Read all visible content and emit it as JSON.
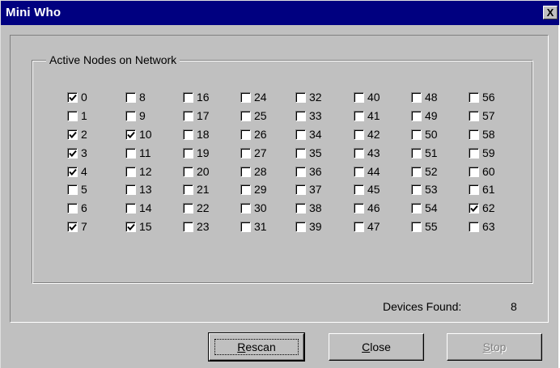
{
  "window": {
    "title": "Mini Who",
    "close_glyph": "X"
  },
  "group": {
    "label": "Active Nodes on Network"
  },
  "nodes": [
    {
      "id": "0",
      "checked": true
    },
    {
      "id": "1",
      "checked": false
    },
    {
      "id": "2",
      "checked": true
    },
    {
      "id": "3",
      "checked": true
    },
    {
      "id": "4",
      "checked": true
    },
    {
      "id": "5",
      "checked": false
    },
    {
      "id": "6",
      "checked": false
    },
    {
      "id": "7",
      "checked": true
    },
    {
      "id": "8",
      "checked": false
    },
    {
      "id": "9",
      "checked": false
    },
    {
      "id": "10",
      "checked": true
    },
    {
      "id": "11",
      "checked": false
    },
    {
      "id": "12",
      "checked": false
    },
    {
      "id": "13",
      "checked": false
    },
    {
      "id": "14",
      "checked": false
    },
    {
      "id": "15",
      "checked": true
    },
    {
      "id": "16",
      "checked": false
    },
    {
      "id": "17",
      "checked": false
    },
    {
      "id": "18",
      "checked": false
    },
    {
      "id": "19",
      "checked": false
    },
    {
      "id": "20",
      "checked": false
    },
    {
      "id": "21",
      "checked": false
    },
    {
      "id": "22",
      "checked": false
    },
    {
      "id": "23",
      "checked": false
    },
    {
      "id": "24",
      "checked": false
    },
    {
      "id": "25",
      "checked": false
    },
    {
      "id": "26",
      "checked": false
    },
    {
      "id": "27",
      "checked": false
    },
    {
      "id": "28",
      "checked": false
    },
    {
      "id": "29",
      "checked": false
    },
    {
      "id": "30",
      "checked": false
    },
    {
      "id": "31",
      "checked": false
    },
    {
      "id": "32",
      "checked": false
    },
    {
      "id": "33",
      "checked": false
    },
    {
      "id": "34",
      "checked": false
    },
    {
      "id": "35",
      "checked": false
    },
    {
      "id": "36",
      "checked": false
    },
    {
      "id": "37",
      "checked": false
    },
    {
      "id": "38",
      "checked": false
    },
    {
      "id": "39",
      "checked": false
    },
    {
      "id": "40",
      "checked": false
    },
    {
      "id": "41",
      "checked": false
    },
    {
      "id": "42",
      "checked": false
    },
    {
      "id": "43",
      "checked": false
    },
    {
      "id": "44",
      "checked": false
    },
    {
      "id": "45",
      "checked": false
    },
    {
      "id": "46",
      "checked": false
    },
    {
      "id": "47",
      "checked": false
    },
    {
      "id": "48",
      "checked": false
    },
    {
      "id": "49",
      "checked": false
    },
    {
      "id": "50",
      "checked": false
    },
    {
      "id": "51",
      "checked": false
    },
    {
      "id": "52",
      "checked": false
    },
    {
      "id": "53",
      "checked": false
    },
    {
      "id": "54",
      "checked": false
    },
    {
      "id": "55",
      "checked": false
    },
    {
      "id": "56",
      "checked": false
    },
    {
      "id": "57",
      "checked": false
    },
    {
      "id": "58",
      "checked": false
    },
    {
      "id": "59",
      "checked": false
    },
    {
      "id": "60",
      "checked": false
    },
    {
      "id": "61",
      "checked": false
    },
    {
      "id": "62",
      "checked": true
    },
    {
      "id": "63",
      "checked": false
    }
  ],
  "status": {
    "devices_found_label": "Devices Found:",
    "devices_found_value": "8"
  },
  "buttons": {
    "rescan": {
      "label": "Rescan",
      "mnemonic": "R",
      "state": "default"
    },
    "close": {
      "label": "Close",
      "mnemonic": "C",
      "state": "enabled"
    },
    "stop": {
      "label": "Stop",
      "mnemonic": "S",
      "state": "disabled"
    }
  }
}
